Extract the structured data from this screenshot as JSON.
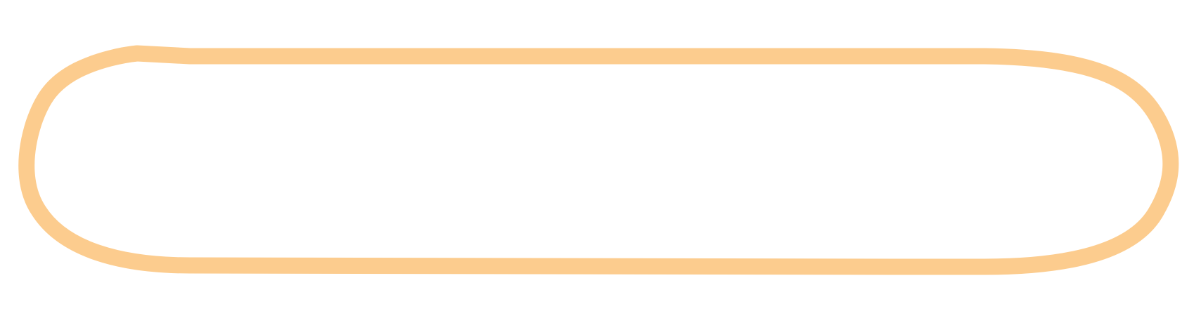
{
  "outline": {
    "shape": "rounded-rectangle",
    "stroke_color": "#FCCC8E",
    "fill_color": "none"
  },
  "canvas": {
    "background_color": "#FFFFFF"
  }
}
